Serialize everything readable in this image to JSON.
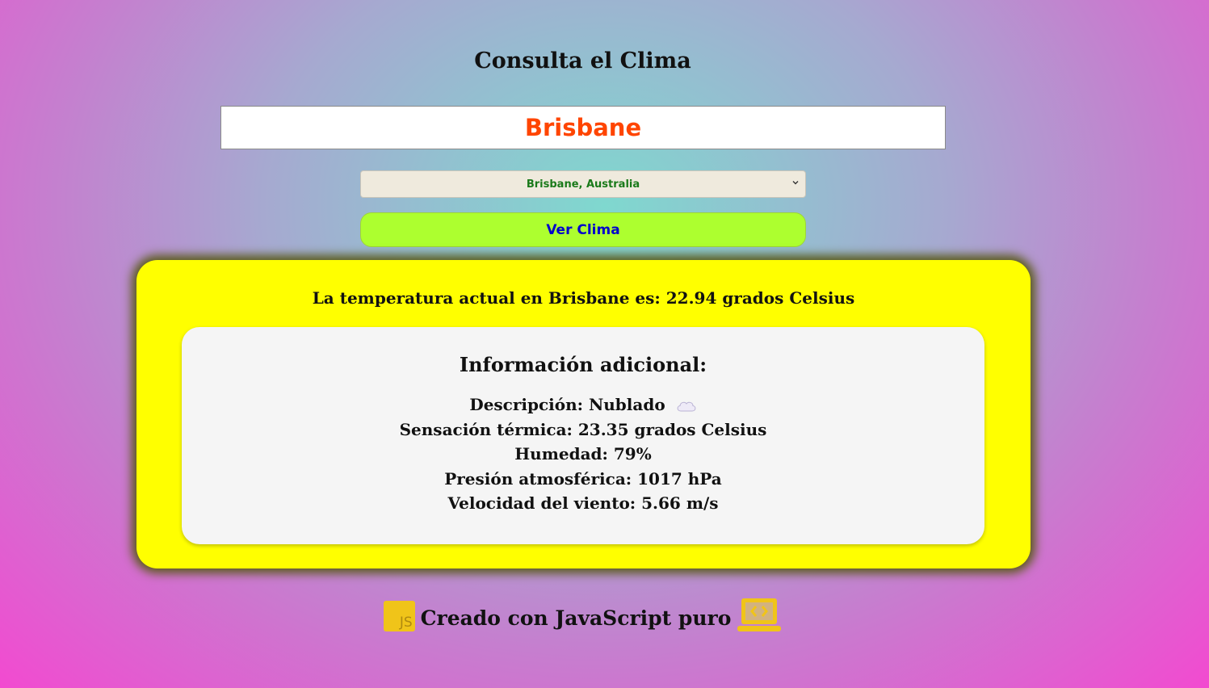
{
  "page": {
    "title": "Consulta el Clima"
  },
  "search": {
    "value": "Brisbane"
  },
  "location_select": {
    "selected": "Brisbane, Australia"
  },
  "action": {
    "button_label": "Ver Clima"
  },
  "result": {
    "temperature_text": "La temperatura actual en Brisbane es: 22.94 grados Celsius",
    "info_title": "Información adicional:",
    "description": "Descripción: Nublado",
    "description_icon": "cloud-icon",
    "feels_like": "Sensación térmica: 23.35 grados Celsius",
    "humidity": "Humedad: 79%",
    "pressure": "Presión atmosférica: 1017 hPa",
    "wind": "Velocidad del viento: 5.66 m/s"
  },
  "footer": {
    "text": "Creado con JavaScript puro",
    "js_badge": "JS",
    "left_icon": "javascript-icon",
    "right_icon": "laptop-code-icon"
  },
  "colors": {
    "input_text": "#ff4500",
    "button_bg": "#adff2f",
    "button_text": "#0000cd",
    "result_bg": "#ffff00",
    "select_text": "#1a7a1a",
    "icon_gold": "#f0c419"
  }
}
